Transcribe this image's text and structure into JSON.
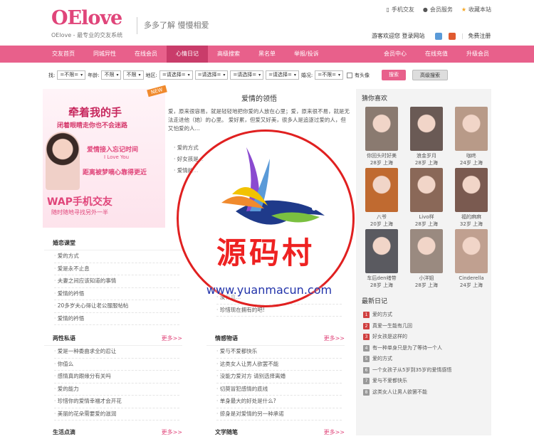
{
  "header": {
    "logo": "OElove",
    "logo_sub": "OElove - 最专业的交友系统",
    "slogan": "多多了解  慢慢相爱",
    "top_links": [
      "手机交友",
      "会员服务",
      "收藏本站"
    ],
    "welcome": "游客欢迎您  登录网站",
    "register": "免费注册"
  },
  "nav": {
    "items": [
      "交友首页",
      "同城异性",
      "在线会员",
      "心情日记",
      "高级搜索",
      "黑名单",
      "举报/投诉"
    ],
    "right_items": [
      "会员中心",
      "在线充值",
      "升级会员"
    ],
    "active": "心情日记"
  },
  "search": {
    "label_sex": "找:",
    "sex": "=不限=",
    "label_age": "年龄:",
    "age_from": "不限",
    "age_to": "不限",
    "label_area": "地区:",
    "area1": "=请选择=",
    "area2": "=请选择=",
    "area3": "=请选择=",
    "area4": "=请选择=",
    "label_marriage": "婚况:",
    "marriage": "=不限=",
    "has_photo": "有头像",
    "search_btn": "搜索",
    "adv_btn": "高级搜索"
  },
  "banner": {
    "new": "NEW",
    "t1": "牵着我的手",
    "t2": "闭着眼睛走你也不会迷路",
    "t3": "爱情接入忘记时间",
    "t4": "I Love You",
    "t5": "距离被梦嘀心靠得更近",
    "wap": "WAP手机交友",
    "wap2": "随时随地寻找另外一半"
  },
  "article": {
    "title": "爱情的领悟",
    "body": "爱，原来很容易，就是轻轻地把你爱的人放在心里；爱，原来很不易，就是无法走进他（她）的心里。                        爱好累，但爱又好美，很多人是追逐过爱的人，但又怕爱的人...",
    "links": [
      "爱的方式",
      "好女孩是...",
      "爱情的..."
    ]
  },
  "box_mood": {
    "title": "婚恋课堂",
    "items": [
      "爱的方式",
      "爱是永不止息",
      "夫妻之间应该知道的事情",
      "爱情的衿悟",
      "20多岁夫心得让老公服服帖帖",
      "爱情的衿悟"
    ]
  },
  "box_talk": {
    "title": "两性私语",
    "more": "更多>>",
    "items": [
      "爱是一种委曲求全的忍让",
      "你值么",
      "感情真的跟缘分有关吗",
      "爱的能力",
      "珍惜你的爱情幸福才会开花",
      "美丽的花朵需要爱的滋润"
    ]
  },
  "box_story": {
    "title": "情感物语",
    "more": "更多>>",
    "items": [
      "爱与不爱都快乐",
      "这类女人让男人欲罢不能",
      "没能力爱对方 请别选择离婚",
      "切莫冒犯感情的底线",
      "单身最大的好处是什么?",
      "掠身是对爱情的另一种承诺"
    ],
    "top_items": [
      "没有真...",
      "珍惜现在拥有的吧!"
    ]
  },
  "box_life": {
    "title": "生活点滴",
    "more": "更多>>"
  },
  "box_article": {
    "title": "文学随笔",
    "more": "更多>>"
  },
  "sidebar": {
    "guess_title": "猜你喜欢",
    "members": [
      {
        "name": "你回头时好美",
        "info": "28岁 上海",
        "color": "#8a7a70"
      },
      {
        "name": "浪金岁月",
        "info": "28岁 上海",
        "color": "#6a5a55"
      },
      {
        "name": "咖咚",
        "info": "24岁 上海",
        "color": "#b89a88"
      },
      {
        "name": "八爷",
        "info": "20岁 上海",
        "color": "#c06a30"
      },
      {
        "name": "Livo样",
        "info": "28岁 上海",
        "color": "#8a6858"
      },
      {
        "name": "福的麻麻",
        "info": "32岁 上海",
        "color": "#7a5a50"
      },
      {
        "name": "车后den绪带",
        "info": "28岁 上海",
        "color": "#5a5a60"
      },
      {
        "name": "小洋姐",
        "info": "28岁 上海",
        "color": "#9a8a80"
      },
      {
        "name": "Cinderella",
        "info": "24岁 上海",
        "color": "#c0a090"
      }
    ],
    "recent_title": "最新日记",
    "recent": [
      "爱的方式",
      "真爱一生能有几回",
      "好女孩是这样的",
      "有一种单身只是为了等待一个人",
      "爱的方式",
      "一个女孩子从5岁到35岁的爱情感悟",
      "爱与不爱都快乐",
      "这类女人让男人欲罢不能"
    ]
  },
  "watermark": {
    "text": "源码村",
    "url": "www.yuanmacun.com"
  }
}
